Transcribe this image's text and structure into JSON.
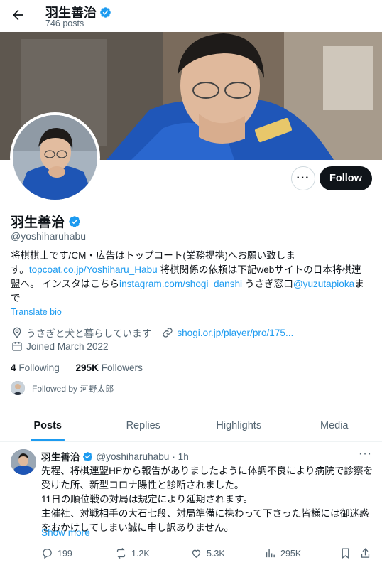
{
  "header": {
    "name": "羽生善治",
    "posts": "746 posts"
  },
  "profile": {
    "name": "羽生善治",
    "handle": "@yoshiharuhabu",
    "follow_label": "Follow",
    "more_label": "···",
    "bio": {
      "line1": "将棋棋士です/CM・広告はトップコート(業務提携)へお願い致しま",
      "line2_a": "す。",
      "link1": "topcoat.co.jp/Yoshiharu_Habu",
      "line2_b": " 将棋関係の依頼は下記webサイトの日本将棋連",
      "line3_a": "盟へ。 インスタはこちら",
      "link2": "instagram.com/shogi_danshi",
      "line3_b": " うさぎ窓口",
      "link3": "@yuzutapioka",
      "line3_c": "ま",
      "line4": "で"
    },
    "translate_label": "Translate bio",
    "location": "うさぎと犬と暮らしています",
    "website": "shogi.or.jp/player/pro/175...",
    "joined": "Joined March 2022",
    "following_count": "4",
    "following_label": "Following",
    "followers_count": "295K",
    "followers_label": "Followers",
    "followed_by": "Followed by 河野太郎"
  },
  "tabs": [
    "Posts",
    "Replies",
    "Highlights",
    "Media"
  ],
  "tweet": {
    "name": "羽生善治",
    "handle": "@yoshiharuhabu",
    "time": "· 1h",
    "line1": "先程、将棋連盟HPから報告がありましたように体調不良により病院で診察を",
    "line2": "受けた所、新型コロナ陽性と診断されました。",
    "line3": "11日の順位戦の対局は規定により延期されます。",
    "line4": "主催社、対戦相手の大石七段、対局準備に携わって下さった皆様には御迷惑",
    "line5": "をおかけしてしまい誠に申し訳ありません。",
    "show_more": "Show more",
    "replies": "199",
    "reposts": "1.2K",
    "likes": "5.3K",
    "views": "295K"
  },
  "colors": {
    "accent": "#1d9bf0",
    "text": "#0f1419",
    "muted": "#536471"
  }
}
